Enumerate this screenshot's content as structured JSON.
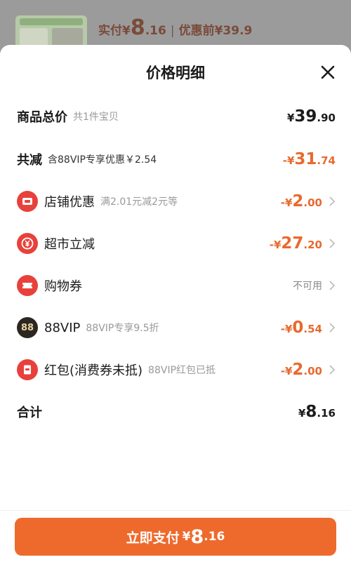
{
  "background": {
    "pay_prefix": "实付",
    "pay_currency": "¥",
    "pay_int": "8",
    "pay_dec": ".16",
    "separator": "|",
    "original_label": "优惠前¥39.9"
  },
  "sheet": {
    "title": "价格明细",
    "close_icon": "close-icon"
  },
  "rows": {
    "total": {
      "label": "商品总价",
      "sub": "共1件宝贝",
      "currency": "¥",
      "int": "39",
      "dec": ".90"
    },
    "discount": {
      "label": "共减",
      "sub": "含88VIP专享优惠￥2.54",
      "currency": "-¥",
      "int": "31",
      "dec": ".74"
    },
    "store": {
      "label": "店铺优惠",
      "sub": "满2.01元减2元等",
      "currency": "-¥",
      "int": "2",
      "dec": ".00",
      "icon": "store-coupon-icon"
    },
    "market": {
      "label": "超市立减",
      "sub": "",
      "currency": "-¥",
      "int": "27",
      "dec": ".20",
      "icon": "yuan-discount-icon"
    },
    "voucher": {
      "label": "购物券",
      "status": "不可用",
      "icon": "ticket-icon"
    },
    "vip": {
      "label": "88VIP",
      "sub": "88VIP专享9.5折",
      "currency": "-¥",
      "int": "0",
      "dec": ".54",
      "icon_text": "88"
    },
    "redpacket": {
      "label": "红包(消费券未抵)",
      "sub": "88VIP红包已抵",
      "currency": "-¥",
      "int": "2",
      "dec": ".00",
      "icon": "red-packet-icon"
    },
    "sum": {
      "label": "合计",
      "currency": "¥",
      "int": "8",
      "dec": ".16"
    }
  },
  "footer": {
    "button_label": "立即支付",
    "currency": "¥",
    "int": "8",
    "dec": ".16"
  },
  "colors": {
    "accent": "#ee6a2c",
    "discount_text": "#e86a2e",
    "icon_red": "#e8413b",
    "icon_black": "#2d2722"
  }
}
